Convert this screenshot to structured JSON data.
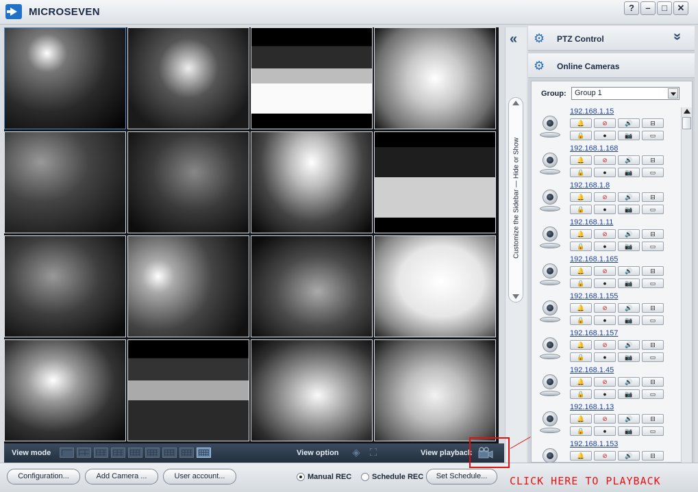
{
  "app": {
    "title": "MICROSEVEN"
  },
  "window_controls": {
    "help": "?",
    "minimize": "–",
    "maximize": "□",
    "close": "✕"
  },
  "video_bar": {
    "view_mode_label": "View mode",
    "view_option_label": "View option",
    "view_playback_label": "View playback",
    "layout_count": 9,
    "active_layout": 9
  },
  "sidebar_toggle": {
    "label": "Customize the Sidebar — Hide or Show"
  },
  "panel": {
    "ptz_title": "PTZ Control",
    "online_title": "Online Cameras",
    "group_label": "Group:",
    "group_value": "Group 1"
  },
  "cameras": [
    {
      "ip": "192.168.1.15",
      "alert": false
    },
    {
      "ip": "192.168.1.168",
      "alert": false
    },
    {
      "ip": "192.168.1.8",
      "alert": false
    },
    {
      "ip": "192.168.1.11",
      "alert": false
    },
    {
      "ip": "192.168.1.165",
      "alert": false
    },
    {
      "ip": "192.168.1.155",
      "alert": false
    },
    {
      "ip": "192.168.1.157",
      "alert": false
    },
    {
      "ip": "192.168.1.45",
      "alert": false
    },
    {
      "ip": "192.168.1.13",
      "alert": true
    },
    {
      "ip": "192.168.1.153",
      "alert": false
    }
  ],
  "toolbar": {
    "configuration": "Configuration...",
    "add_camera": "Add Camera ...",
    "user_account": "User account...",
    "manual_rec": "Manual REC",
    "schedule_rec": "Schedule REC",
    "set_schedule": "Set Schedule...",
    "rec_mode": "manual"
  },
  "annotation": {
    "text": "CLICK HERE TO PLAYBACK",
    "color": "#e01010"
  },
  "colors": {
    "accent": "#2b6cb3",
    "link": "#1f3fa8",
    "alert": "#d21919"
  }
}
